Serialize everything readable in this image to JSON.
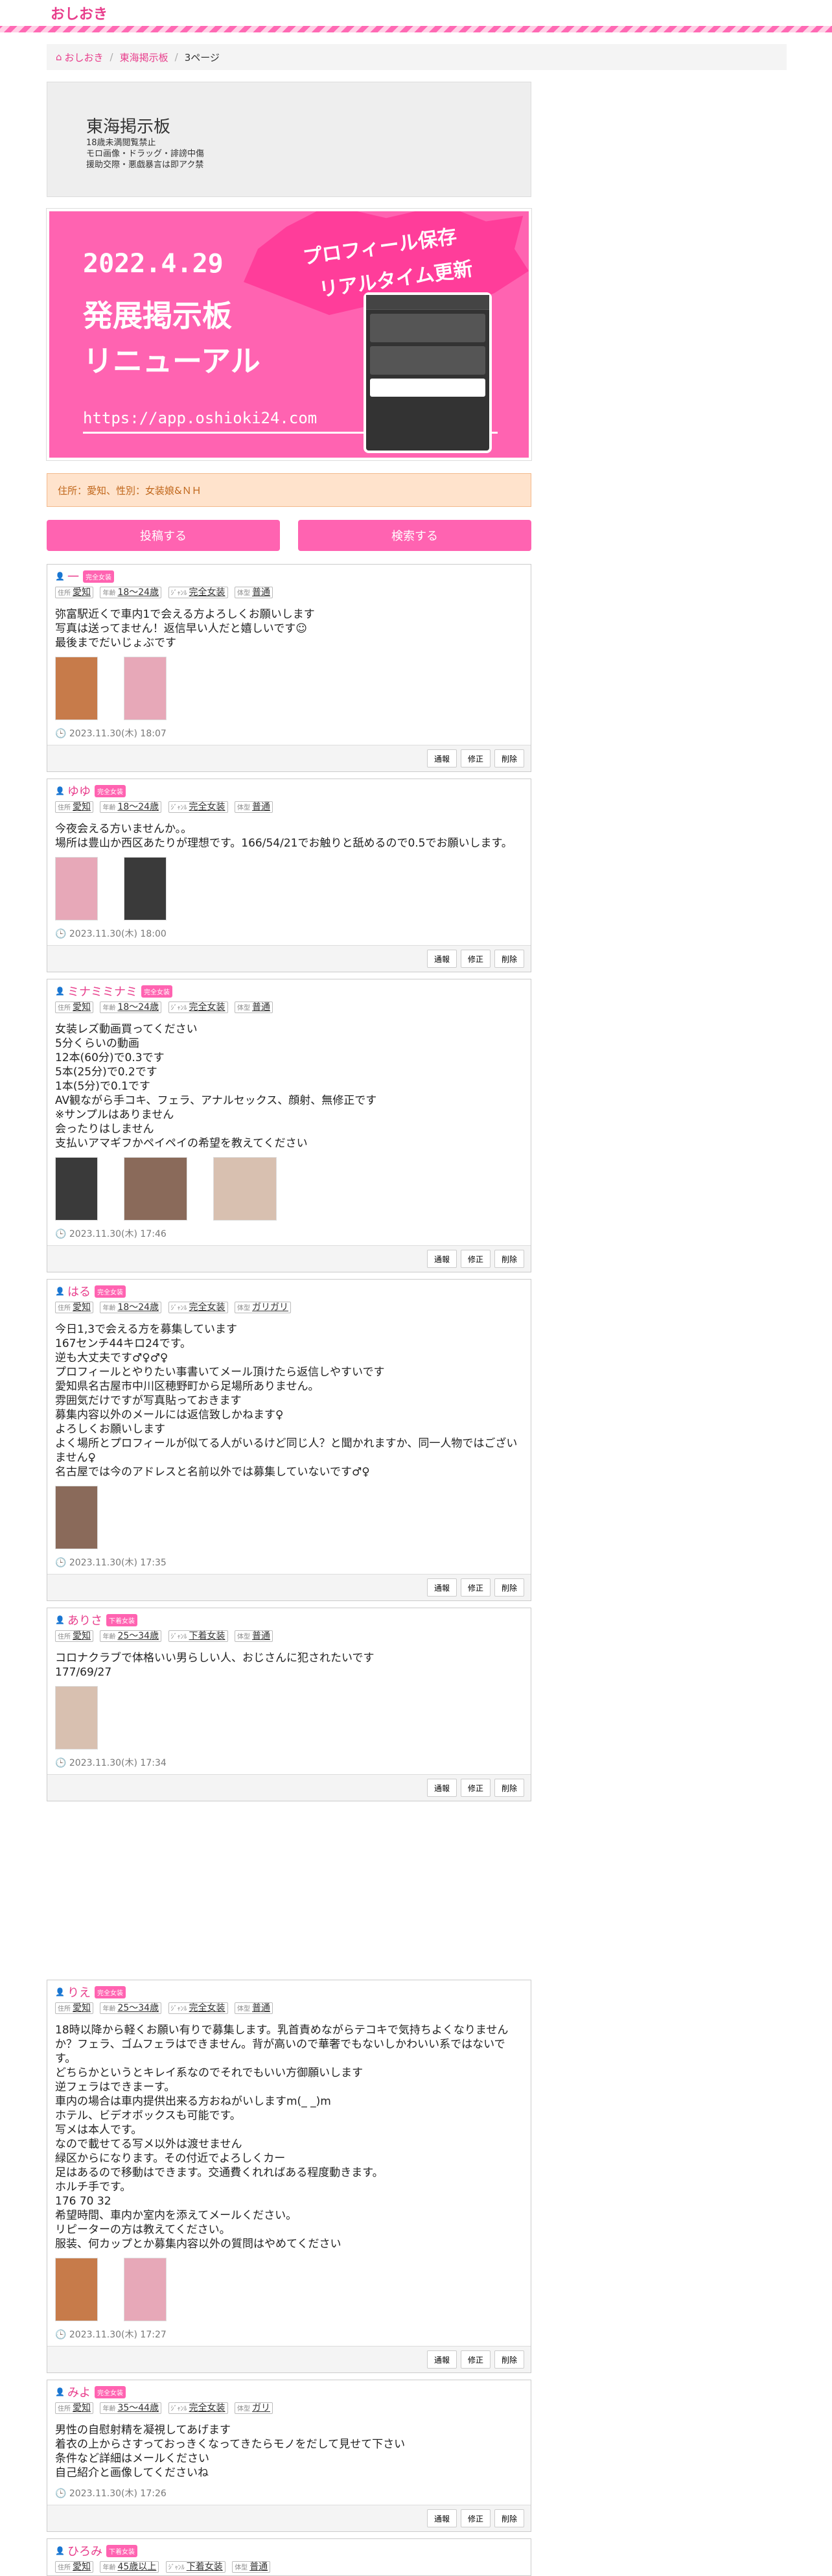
{
  "header": {
    "logo": "おしおき"
  },
  "breadcrumb": {
    "home": "おしおき",
    "board": "東海掲示板",
    "current": "3ページ"
  },
  "info": {
    "title": "東海掲示板",
    "lines": [
      "18歳未満閲覧禁止",
      "モロ画像・ドラッグ・誹謗中傷",
      "援助交際・悪戯暴言は即アク禁"
    ]
  },
  "banner": {
    "date": "2022.4.29",
    "burst_line1": "プロフィール保存",
    "burst_line2": "リアルタイム更新",
    "headline1": "発展掲示板",
    "headline2": "リニューアル",
    "url": "https://app.oshioki24.com"
  },
  "notice": "住所：愛知、性別：女装娘&ＮＨ",
  "actions": {
    "post": "投稿する",
    "search": "検索する"
  },
  "labels": {
    "addr": "住所",
    "age": "年齢",
    "type": "ｼﾞｬﾝﾙ",
    "body": "体型",
    "report": "通報",
    "edit": "修正",
    "delete": "削除"
  },
  "posts": [
    {
      "name": "一",
      "badge": "完全女装",
      "addr": "愛知",
      "age": "18〜24歳",
      "type": "完全女装",
      "body": "普通",
      "text": "弥富駅近くで車内1で会える方よろしくお願いします\n写真は送ってません！返信早い人だと嬉しいです☺︎\n最後までだいじょぶです",
      "date": "2023.11.30(木) 18:07",
      "thumbs": 2
    },
    {
      "name": "ゆゆ",
      "badge": "完全女装",
      "addr": "愛知",
      "age": "18〜24歳",
      "type": "完全女装",
      "body": "普通",
      "text": "今夜会える方いませんか。。\n場所は豊山か西区あたりが理想です。166/54/21でお触りと舐めるので0.5でお願いします。",
      "date": "2023.11.30(木) 18:00",
      "thumbs": 2
    },
    {
      "name": "ミナミミナミ",
      "badge": "完全女装",
      "addr": "愛知",
      "age": "18〜24歳",
      "type": "完全女装",
      "body": "普通",
      "text": "女装レズ動画買ってください\n5分くらいの動画\n12本(60分)で0.3です\n5本(25分)で0.2です\n1本(5分)で0.1です\nAV観ながら手コキ、フェラ、アナルセックス、顔射、無修正です\n※サンプルはありません\n会ったりはしません\n支払いアマギフかペイペイの希望を教えてください",
      "date": "2023.11.30(木) 17:46",
      "thumbs": 3
    },
    {
      "name": "はる",
      "badge": "完全女装",
      "addr": "愛知",
      "age": "18〜24歳",
      "type": "完全女装",
      "body": "ガリガリ",
      "text": "今日1,3で会える方を募集しています\n167センチ44キロ24です。\n逆も大丈夫です♂♀♂♀\nプロフィールとやりたい事書いてメール頂けたら返信しやすいです\n愛知県名古屋市中川区穂野町から足場所ありません。\n雰囲気だけですが写真貼っておきます\n募集内容以外のメールには返信致しかねます♀\nよろしくお願いします\nよく場所とプロフィールが似てる人がいるけど同じ人？と聞かれますか、同一人物ではございません♀\n名古屋では今のアドレスと名前以外では募集していないです♂♀",
      "date": "2023.11.30(木) 17:35",
      "thumbs": 1
    },
    {
      "name": "ありさ",
      "badge": "下着女装",
      "addr": "愛知",
      "age": "25〜34歳",
      "type": "下着女装",
      "body": "普通",
      "text": "コロナクラブで体格いい男らしい人、おじさんに犯されたいです\n177/69/27",
      "date": "2023.11.30(木) 17:34",
      "thumbs": 1
    },
    {
      "name": "りえ",
      "badge": "完全女装",
      "addr": "愛知",
      "age": "25〜34歳",
      "type": "完全女装",
      "body": "普通",
      "text": "18時以降から軽くお願い有りで募集します。乳首責めながらテコキで気持ちよくなりませんか？フェラ、ゴムフェラはできません。背が高いので華奢でもないしかわいい系ではないです。\nどちらかというとキレイ系なのでそれでもいい方御願いします\n逆フェラはできまーす。\n車内の場合は車内提供出来る方おねがいしますm(_ _)m\nホテル、ビデオボックスも可能です。\n写メは本人です。\nなので載せてる写メ以外は渡せません\n緑区からになります。その付近でよろしくカー\n足はあるので移動はできます。交通費くれればある程度動きます。\nホルチ手です。\n176 70 32\n希望時間、車内か室内を添えてメールください。\nリピーターの方は教えてください。\n服装、何カップとか募集内容以外の質問はやめてください",
      "date": "2023.11.30(木) 17:27",
      "thumbs": 2
    },
    {
      "name": "みよ",
      "badge": "完全女装",
      "addr": "愛知",
      "age": "35〜44歳",
      "type": "完全女装",
      "body": "ガリ",
      "text": "男性の自慰射精を凝視してあげます\n着衣の上からさすっておっきくなってきたらモノをだして見せて下さい\n条件など詳細はメールください\n自己紹介と画像してくださいね",
      "date": "2023.11.30(木) 17:26",
      "thumbs": 0
    },
    {
      "name": "ひろみ",
      "badge": "下着女装",
      "addr": "愛知",
      "age": "45歳以上",
      "type": "下着女装",
      "body": "普通",
      "text": "",
      "date": "",
      "thumbs": 0
    }
  ]
}
